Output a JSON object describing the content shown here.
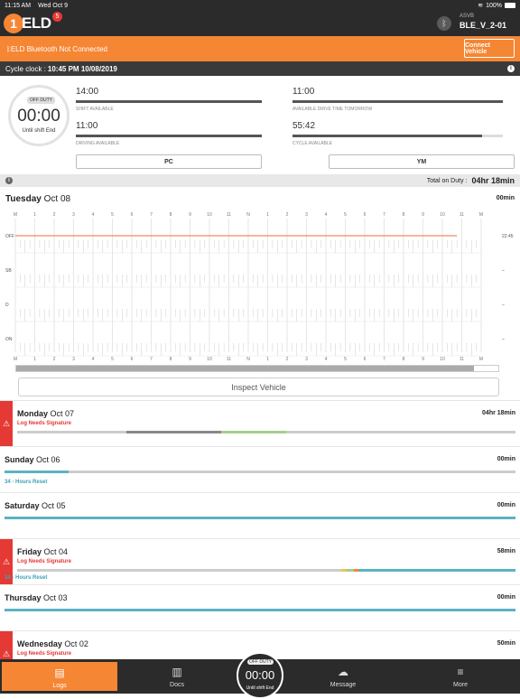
{
  "status_bar": {
    "time": "11:15 AM",
    "date": "Wed Oct 9",
    "battery": "100%"
  },
  "header": {
    "logo_num": "1",
    "logo_text": "ELD",
    "notification_count": "5",
    "asset_label": "ASVB",
    "asset_value": "BLE_V_2-01",
    "bluetooth_message": "ELD Bluetooth Not Connected",
    "connect_button": "Connect Vehicle"
  },
  "cycle": {
    "label": "Cycle clock :",
    "value": "10:45 PM 10/08/2019"
  },
  "clock": {
    "status": "OFF DUTY",
    "value": "00:00",
    "subtitle": "Until shift End"
  },
  "stats": [
    {
      "value": "14:00",
      "label": "SHIFT AVAILABLE",
      "fill": 1.0
    },
    {
      "value": "11:00",
      "label": "AVAILABLE DRIVE TIME TOMORROW",
      "fill": 1.0
    },
    {
      "value": "11:00",
      "label": "DRIVING AVAILABLE",
      "fill": 1.0
    },
    {
      "value": "55:42",
      "label": "CYCLE AVAILABLE",
      "fill": 0.9
    }
  ],
  "modes": {
    "pc": "PC",
    "ym": "YM"
  },
  "duty": {
    "label": "Total on Duty :",
    "value": "04hr 18min"
  },
  "today": {
    "weekday": "Tuesday",
    "date": "Oct 08",
    "total": "00min",
    "end_label": "22:45"
  },
  "grid": {
    "hour_labels": [
      "M",
      "1",
      "2",
      "3",
      "4",
      "5",
      "6",
      "7",
      "8",
      "9",
      "10",
      "11",
      "N",
      "1",
      "2",
      "3",
      "4",
      "5",
      "6",
      "7",
      "8",
      "9",
      "10",
      "11",
      "M"
    ],
    "row_labels": [
      "OFF",
      "SB",
      "D",
      "ON"
    ],
    "right_labels": [
      "22:45",
      "–",
      "–",
      "–"
    ],
    "duty_line_color": "#f26b3a"
  },
  "inspect_button": "Inspect Vehicle",
  "logs": [
    {
      "weekday": "Monday",
      "date": "Oct 07",
      "total": "04hr 18min",
      "warn": true,
      "need": "Log Needs Signature",
      "reset": "",
      "variant": "monday"
    },
    {
      "weekday": "Sunday",
      "date": "Oct 06",
      "total": "00min",
      "warn": false,
      "need": "",
      "reset": "34 - Hours Reset",
      "variant": "sunday"
    },
    {
      "weekday": "Saturday",
      "date": "Oct 05",
      "total": "00min",
      "warn": false,
      "need": "",
      "reset": "",
      "variant": "plain"
    },
    {
      "weekday": "Friday",
      "date": "Oct 04",
      "total": "58min",
      "warn": true,
      "need": "Log Needs Signature",
      "reset": "34 - Hours Reset",
      "variant": "friday"
    },
    {
      "weekday": "Thursday",
      "date": "Oct 03",
      "total": "00min",
      "warn": false,
      "need": "",
      "reset": "",
      "variant": "plain"
    },
    {
      "weekday": "Wednesday",
      "date": "Oct 02",
      "total": "50min",
      "warn": true,
      "need": "Log Needs Signature",
      "reset": "",
      "variant": "plain"
    }
  ],
  "tabs": {
    "logs": "Logs",
    "docs": "Docs",
    "message": "Message",
    "more": "More"
  },
  "center_clock": {
    "status": "OFF DUTY",
    "value": "00:00",
    "subtitle": "Until shift End"
  },
  "colors": {
    "accent": "#f58634",
    "dark": "#2b2b2b",
    "warning": "#e53935",
    "teal": "#5cb3c2"
  }
}
